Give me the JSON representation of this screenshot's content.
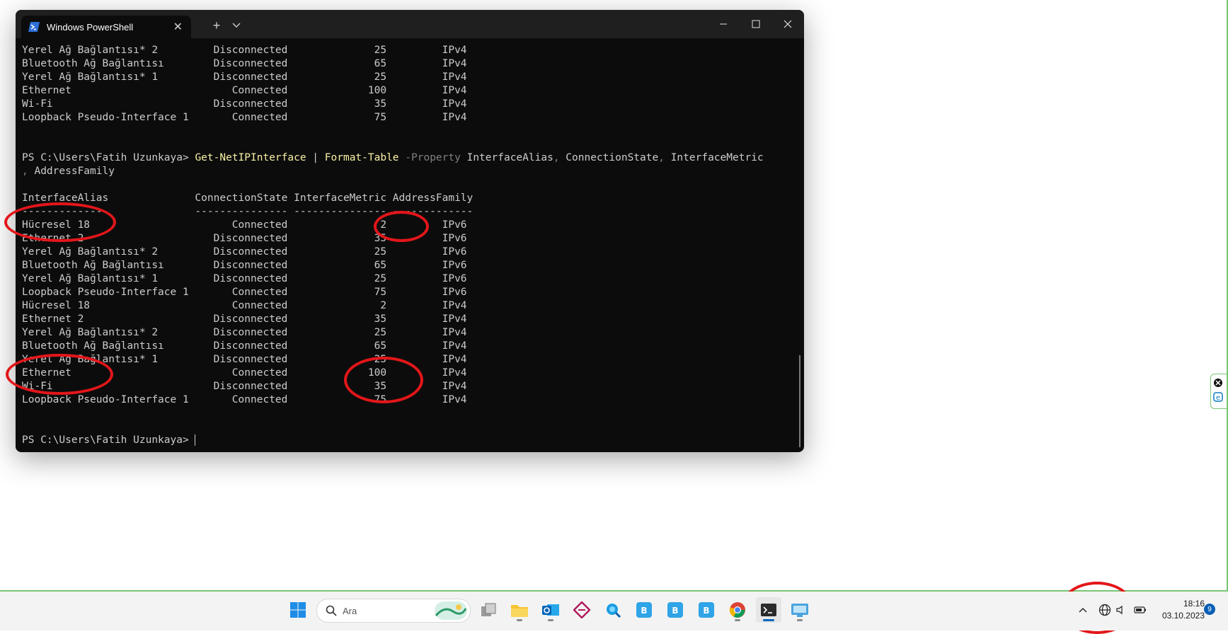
{
  "window": {
    "tab_title": "Windows PowerShell",
    "new_tab": "+",
    "dropdown": "⌄"
  },
  "console": {
    "top_rows": [
      [
        "Yerel Ağ Bağlantısı* 2",
        "Disconnected",
        "25",
        "IPv4"
      ],
      [
        "Bluetooth Ağ Bağlantısı",
        "Disconnected",
        "65",
        "IPv4"
      ],
      [
        "Yerel Ağ Bağlantısı* 1",
        "Disconnected",
        "25",
        "IPv4"
      ],
      [
        "Ethernet",
        "Connected",
        "100",
        "IPv4"
      ],
      [
        "Wi-Fi",
        "Disconnected",
        "35",
        "IPv4"
      ],
      [
        "Loopback Pseudo-Interface 1",
        "Connected",
        "75",
        "IPv4"
      ]
    ],
    "prompt": "PS C:\\Users\\Fatih Uzunkaya>",
    "command": {
      "cmd1": "Get-NetIPInterface",
      "pipe": "|",
      "cmd2": "Format-Table",
      "param": "-Property",
      "args_line1_a": "InterfaceAlias",
      "args_line1_b": "ConnectionState",
      "args_line1_c": "InterfaceMetric",
      "args_line2": "AddressFamily"
    },
    "headers": [
      "InterfaceAlias",
      "ConnectionState",
      "InterfaceMetric",
      "AddressFamily"
    ],
    "underlines": [
      "--------------",
      "---------------",
      "---------------",
      "-------------"
    ],
    "rows": [
      [
        "Hücresel 18",
        "Connected",
        "2",
        "IPv6"
      ],
      [
        "Ethernet 2",
        "Disconnected",
        "35",
        "IPv6"
      ],
      [
        "Yerel Ağ Bağlantısı* 2",
        "Disconnected",
        "25",
        "IPv6"
      ],
      [
        "Bluetooth Ağ Bağlantısı",
        "Disconnected",
        "65",
        "IPv6"
      ],
      [
        "Yerel Ağ Bağlantısı* 1",
        "Disconnected",
        "25",
        "IPv6"
      ],
      [
        "Loopback Pseudo-Interface 1",
        "Connected",
        "75",
        "IPv6"
      ],
      [
        "Hücresel 18",
        "Connected",
        "2",
        "IPv4"
      ],
      [
        "Ethernet 2",
        "Disconnected",
        "35",
        "IPv4"
      ],
      [
        "Yerel Ağ Bağlantısı* 2",
        "Disconnected",
        "25",
        "IPv4"
      ],
      [
        "Bluetooth Ağ Bağlantısı",
        "Disconnected",
        "65",
        "IPv4"
      ],
      [
        "Yerel Ağ Bağlantısı* 1",
        "Disconnected",
        "25",
        "IPv4"
      ],
      [
        "Ethernet",
        "Connected",
        "100",
        "IPv4"
      ],
      [
        "Wi-Fi",
        "Disconnected",
        "35",
        "IPv4"
      ],
      [
        "Loopback Pseudo-Interface 1",
        "Connected",
        "75",
        "IPv4"
      ]
    ],
    "final_prompt": "PS C:\\Users\\Fatih Uzunkaya>"
  },
  "taskbar": {
    "search_placeholder": "Ara",
    "apps": [
      "start-icon",
      "task-view-icon",
      "file-explorer-icon",
      "outlook-icon",
      "app-icon",
      "edge-search-icon",
      "teams-icon",
      "teams-icon",
      "teams-icon",
      "chrome-icon",
      "terminal-icon",
      "remote-desktop-icon"
    ],
    "time": "18:16",
    "date": "03.10.2023",
    "notification_count": "9"
  },
  "colors": {
    "terminal_bg": "#0c0c0c",
    "command": "#f9f1a5",
    "annotation": "#e3161a",
    "accent": "#0067c0"
  }
}
